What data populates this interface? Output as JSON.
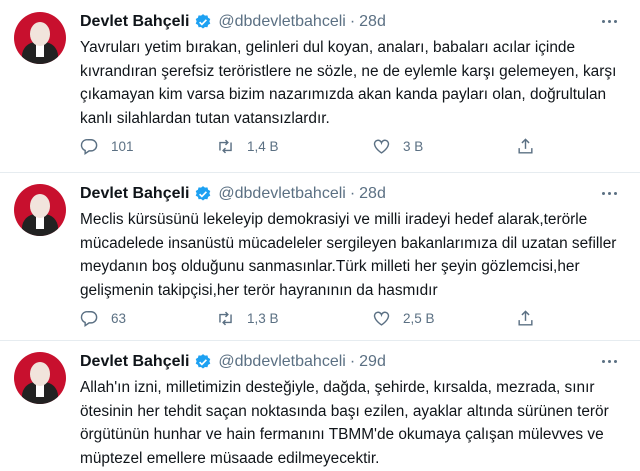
{
  "tweets": [
    {
      "name": "Devlet Bahçeli",
      "handle": "@dbdevletbahceli",
      "separator": "·",
      "time": "28d",
      "text": "Yavruları yetim bırakan, gelinleri dul koyan, anaları, babaları acılar içinde kıvrandıran şerefsiz teröristlere ne sözle, ne de eylemle karşı gelemeyen, karşı çıkamayan kim varsa bizim nazarımızda akan kanda payları olan, doğrultulan kanlı silahlardan tutan vatansızlardır.",
      "replies": "101",
      "retweets": "1,4 B",
      "likes": "3 B"
    },
    {
      "name": "Devlet Bahçeli",
      "handle": "@dbdevletbahceli",
      "separator": "·",
      "time": "28d",
      "text": "Meclis kürsüsünü lekeleyip demokrasiyi ve milli iradeyi hedef alarak,terörle mücadelede insanüstü mücadeleler sergileyen bakanlarımıza dil uzatan sefiller meydanın boş olduğunu sanmasınlar.Türk milleti her şeyin gözlemcisi,her gelişmenin takipçisi,her terör hayranının da hasmıdır",
      "replies": "63",
      "retweets": "1,3 B",
      "likes": "2,5 B"
    },
    {
      "name": "Devlet Bahçeli",
      "handle": "@dbdevletbahceli",
      "separator": "·",
      "time": "29d",
      "text": "Allah'ın izni, milletimizin desteğiyle, dağda, şehirde, kırsalda, mezrada, sınır ötesinin her tehdit saçan noktasında başı ezilen, ayaklar altında sürünen terör örgütünün hunhar ve hain fermanını TBMM'de okumaya çalışan mülevves ve müptezel emellere müsaade edilmeyecektir."
    }
  ],
  "colors": {
    "verified": "#1da1f2",
    "muted": "#5b7083",
    "avatar_bg": "#c8102e"
  }
}
